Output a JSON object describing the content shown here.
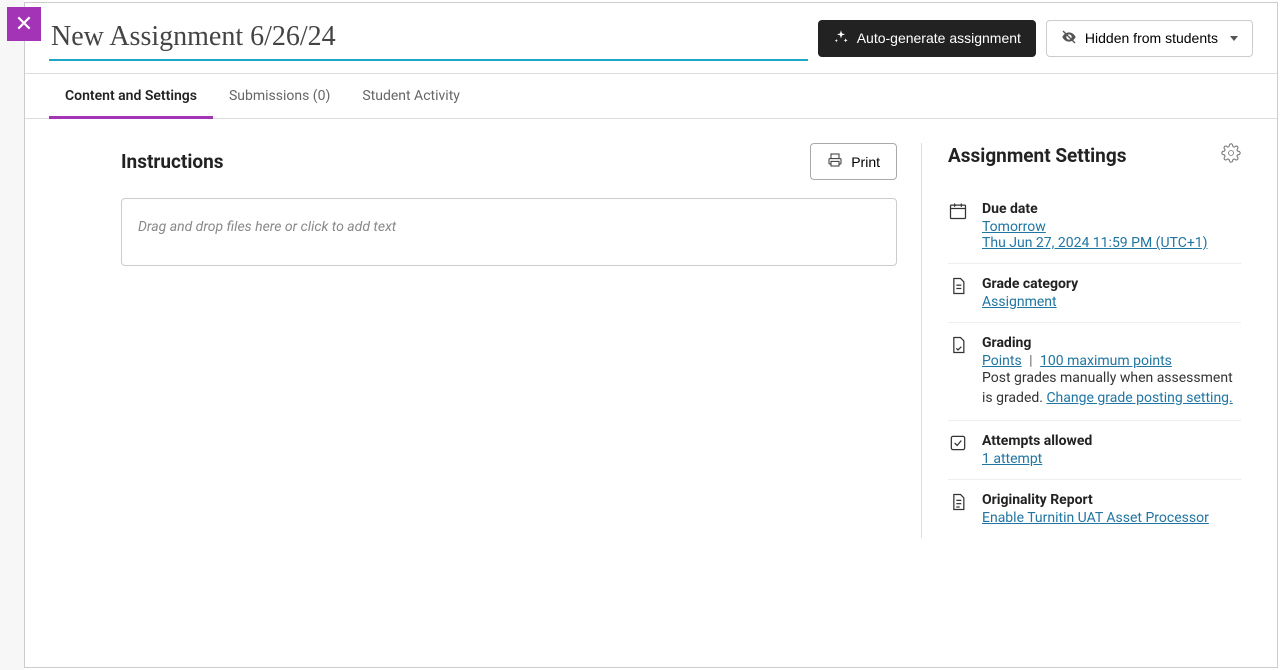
{
  "header": {
    "title_value": "New Assignment 6/26/24",
    "auto_generate": "Auto-generate assignment",
    "visibility": "Hidden from students"
  },
  "tabs": {
    "content": "Content and Settings",
    "submissions": "Submissions (0)",
    "activity": "Student Activity"
  },
  "main": {
    "instructions_heading": "Instructions",
    "print": "Print",
    "dropzone_placeholder": "Drag and drop files here or click to add text"
  },
  "settings": {
    "heading": "Assignment Settings",
    "due": {
      "title": "Due date",
      "relative": "Tomorrow",
      "absolute": "Thu Jun 27, 2024 11:59 PM (UTC+1)"
    },
    "category": {
      "title": "Grade category",
      "value": "Assignment"
    },
    "grading": {
      "title": "Grading",
      "type": "Points",
      "sep": " | ",
      "max": "100 maximum points",
      "note": "Post grades manually when assessment is graded. ",
      "change": "Change grade posting setting."
    },
    "attempts": {
      "title": "Attempts allowed",
      "value": "1 attempt"
    },
    "originality": {
      "title": "Originality Report",
      "value": "Enable Turnitin UAT Asset Processor"
    }
  }
}
